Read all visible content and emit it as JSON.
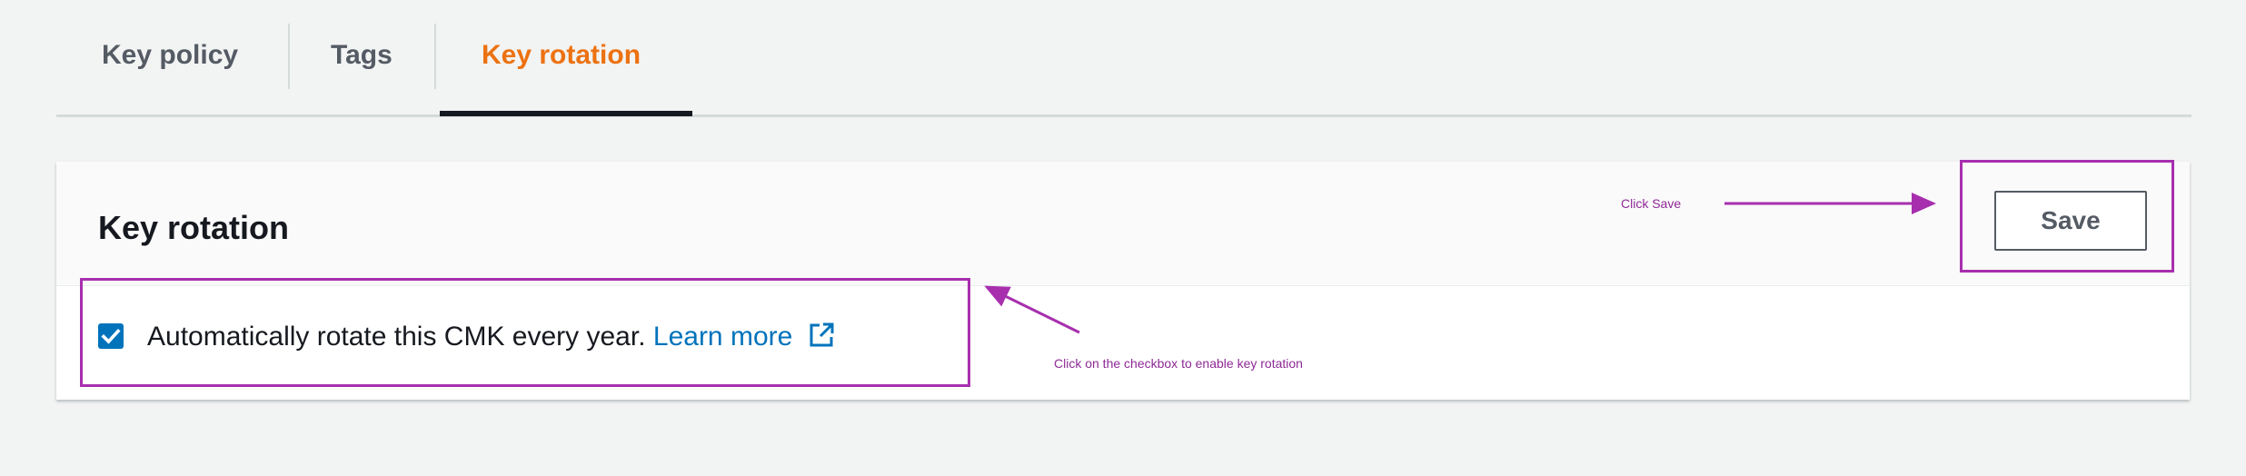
{
  "tabs": [
    {
      "label": "Key policy"
    },
    {
      "label": "Tags"
    },
    {
      "label": "Key rotation"
    }
  ],
  "panel": {
    "title": "Key rotation",
    "save_label": "Save",
    "checkbox": {
      "checked": true,
      "label": "Automatically rotate this CMK every year.",
      "link_text": "Learn more"
    }
  },
  "annotations": {
    "save_hint": "Click Save",
    "checkbox_hint": "Click on the checkbox to enable key rotation",
    "color": "#a72fae"
  },
  "colors": {
    "active_tab": "#ec7211",
    "link": "#0073bb",
    "checkbox": "#0073bb"
  },
  "icons": {
    "checkbox": "checkmark-icon",
    "external_link": "external-link-icon"
  }
}
